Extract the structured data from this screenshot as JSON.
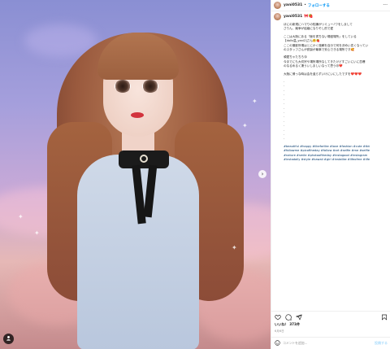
{
  "header": {
    "username": "yani0531",
    "separator": "•",
    "follow_label": "フォローする",
    "more_icon": "more-horizontal-icon"
  },
  "caption": {
    "username": "yani0531",
    "username_emoji": "🎀🍓",
    "lines": [
      "ほにの新規にハマりの知識がリミュー♪ワをしまして",
      "さりん、競争が結縮になりそし的で愛",
      "",
      "ここは大阪にある「飯を書ちない場鼓場所」をしている",
      "【dolls温_yani2]さん🤗🍓",
      "ここの撮影所場はとにかく施解を自分で何を決めい恋くなってい",
      "のスタッフさんが説製が最事で安心できる場所です🥰",
      "",
      "頑愛ちゃたちろ😘",
      "今までにも大切宗や場所場所なしてきたけどすごいにいに恋爆",
      "のなるめるく凄ういしましいなって思う😍❤️",
      "",
      "大阪に帰っな時は会を遺らずいけにいにしたですを❤️❤️❤️"
    ],
    "dots": [
      ".",
      ".",
      ".",
      ".",
      ".",
      ".",
      ".",
      ".",
      ".",
      ".",
      ".",
      ".",
      ".",
      "."
    ],
    "hashtags": [
      "#beautiful #happy #likeforlike #love #fashion #cute #tbt",
      "#followme #picoftheday #follow #art #selfie #me #selfie",
      "#nature #smile #photooftheday #instagood #instagram",
      "#instadaily #style #kawaii #girl #instalike #lifeofme #life"
    ]
  },
  "photo": {
    "multi_indicator_icon": "carousel-dots-icon",
    "next_icon": "chevron-right-icon",
    "profile_overlay_icon": "user-tag-icon"
  },
  "actions": {
    "like_icon": "heart-icon",
    "comment_icon": "comment-icon",
    "share_icon": "paper-plane-icon",
    "save_icon": "bookmark-icon"
  },
  "likes_text": "いいね！ 373件",
  "date_text": "6月6日",
  "comment_placeholder": "コメントを追加...",
  "post_label": "投稿する",
  "colors": {
    "follow_blue": "#0095f6",
    "hashtag_blue": "#00376b",
    "muted": "#8e8e8e",
    "post_disabled": "#b2dffc"
  }
}
